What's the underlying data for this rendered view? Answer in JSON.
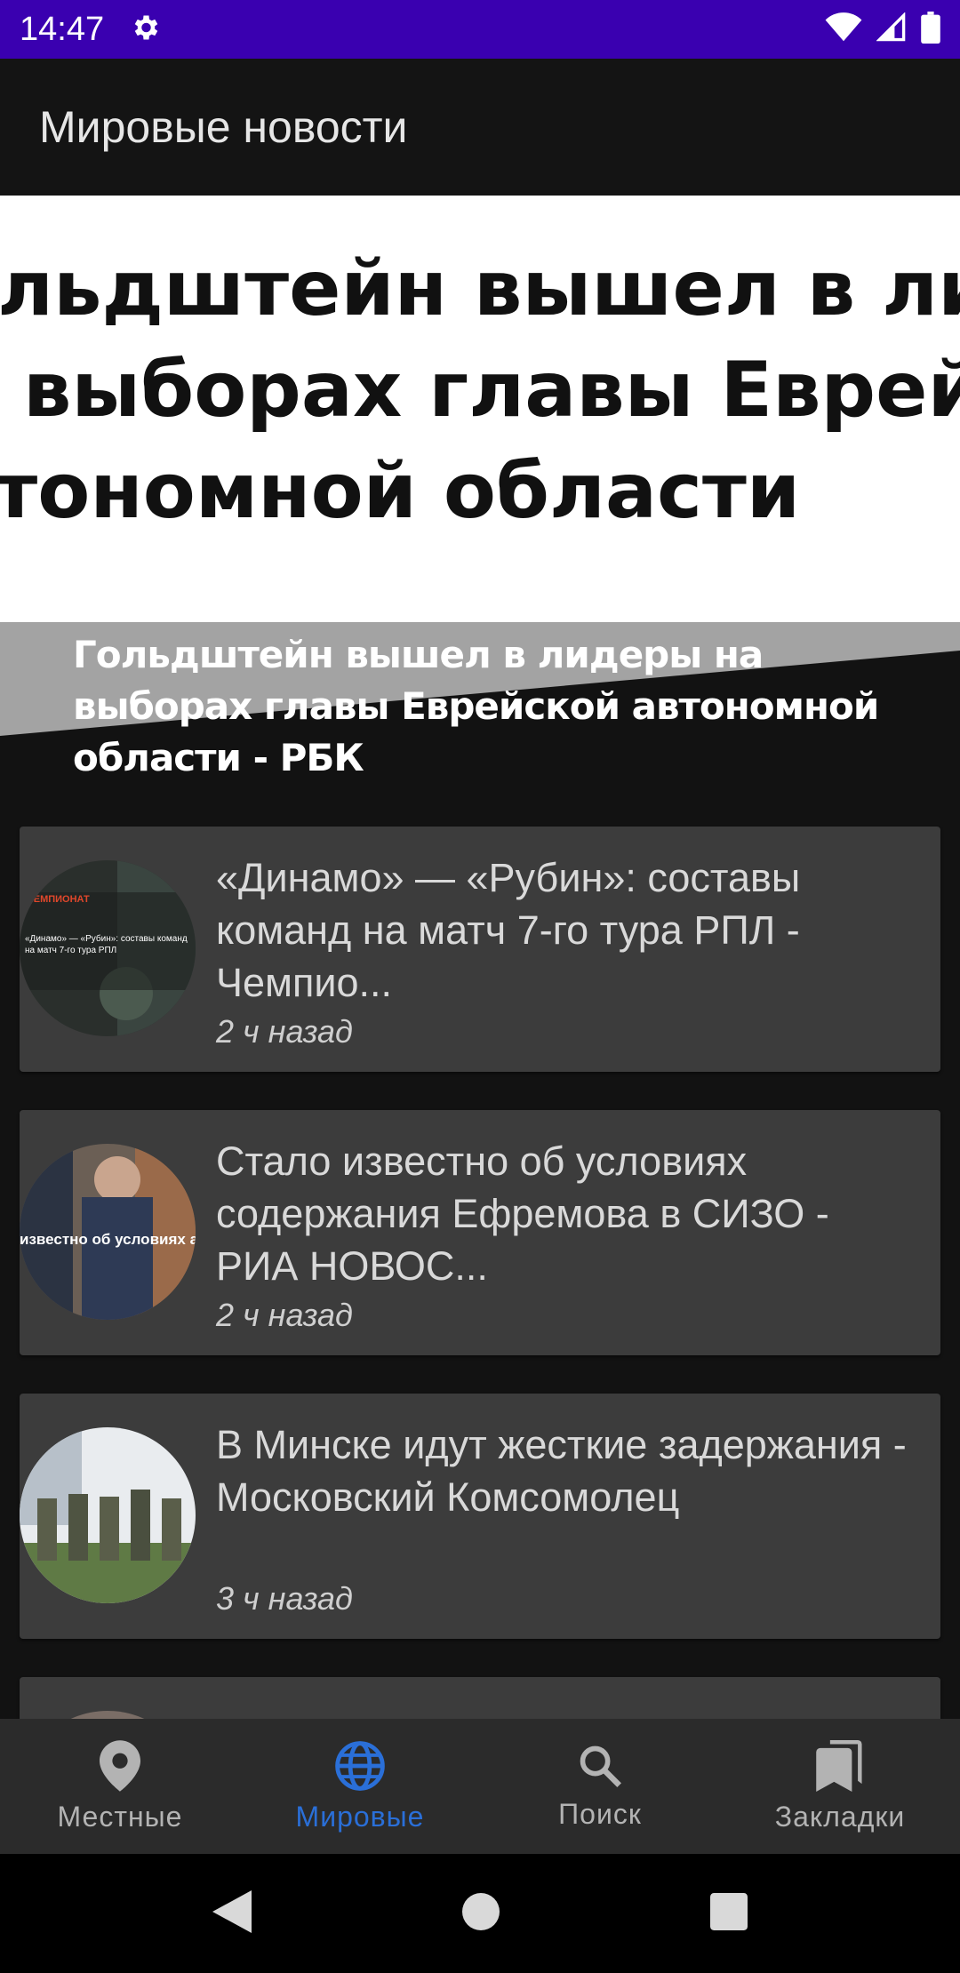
{
  "status_bar": {
    "time": "14:47",
    "icons": [
      "settings-icon",
      "wifi-icon",
      "signal-icon",
      "battery-icon"
    ],
    "background": "#3a00b0"
  },
  "app_bar": {
    "title": "Мировые новости"
  },
  "hero": {
    "image_text": "ольдштейн вышел в ли\nа выборах главы Еврей\nвтономной области",
    "caption": "Гольдштейн вышел в лидеры на выборах главы Еврейской автономной области - РБК"
  },
  "news": [
    {
      "title": "«Динамо» — «Рубин»: составы команд на матч 7-го тура РПЛ - Чемпио...",
      "time": "2 ч назад",
      "thumb_label_top": "ЧЕМПИОНАТ",
      "thumb_label_mid": "«Динамо» — «Рубин»: составы команд на матч 7-го тура РПЛ"
    },
    {
      "title": "Стало известно об условиях содержания Ефремова в СИЗО - РИА НОВОС...",
      "time": "2 ч назад",
      "thumb_label_mid": "известно об условиях ания Ефремова в СИЗ"
    },
    {
      "title": "В Минске идут жесткие задержания - Московский Комсомолец",
      "time": "3 ч назад"
    }
  ],
  "bottom_nav": {
    "items": [
      {
        "label": "Местные",
        "icon": "location-pin-icon",
        "active": false
      },
      {
        "label": "Мировые",
        "icon": "globe-icon",
        "active": true
      },
      {
        "label": "Поиск",
        "icon": "search-icon",
        "active": false
      },
      {
        "label": "Закладки",
        "icon": "bookmarks-icon",
        "active": false
      }
    ],
    "active_color": "#2a6fd8"
  }
}
